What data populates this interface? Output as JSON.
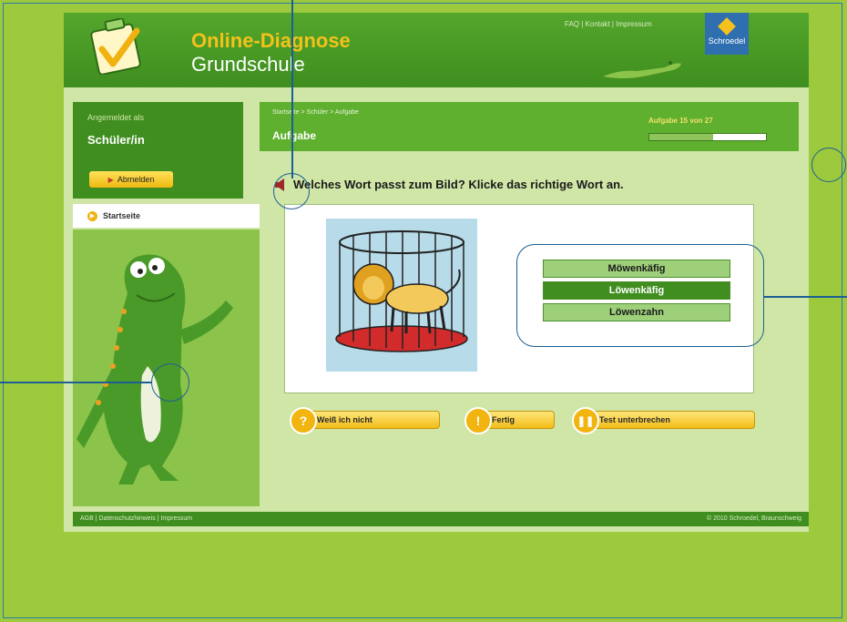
{
  "brand": {
    "line1": "Online-Diagnose",
    "line2": "Grundschule",
    "publisher": "Schroedel"
  },
  "top_links": "FAQ | Kontakt | Impressum",
  "sidebar": {
    "logged_in_label": "Angemeldet als",
    "user_role": "Schüler/in",
    "logout_label": "Abmelden",
    "nav_start": "Startseite"
  },
  "content": {
    "breadcrumb": "Startseite > Schüler > Aufgabe",
    "title": "Aufgabe",
    "task_counter": "Aufgabe 15 von 27",
    "progress_fraction": 0.55,
    "question": "Welches Wort passt zum Bild? Klicke das richtige Wort an.",
    "options": [
      "Möwenkäfig",
      "Löwenkäfig",
      "Löwenzahn"
    ],
    "selected_option": 1
  },
  "actions": {
    "dont_know": "Weiß ich nicht",
    "done": "Fertig",
    "pause": "Test unterbrechen"
  },
  "footer": {
    "left": "AGB | Datenschutzhinweis | Impressum",
    "right": "© 2010 Schroedel, Braunschweig"
  },
  "colors": {
    "page_bg": "#9dca3c",
    "header_green": "#3f8e1f",
    "accent_yellow": "#f2bd18",
    "annotation_blue": "#1d5f95"
  }
}
